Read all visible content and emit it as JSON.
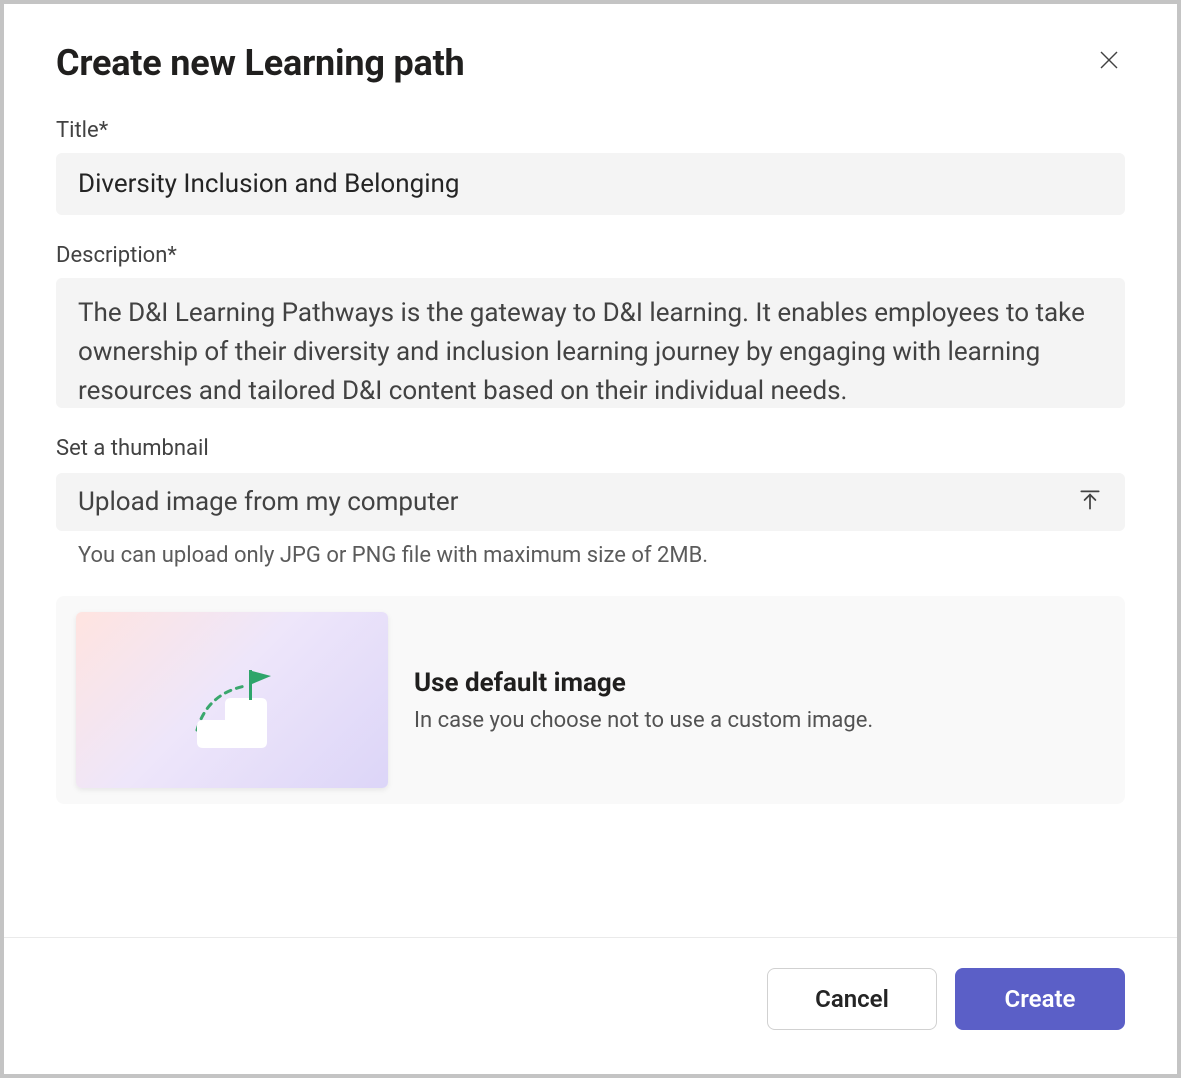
{
  "dialog": {
    "title": "Create new Learning path"
  },
  "fields": {
    "title": {
      "label": "Title*",
      "value": "Diversity Inclusion and Belonging"
    },
    "description": {
      "label": "Description*",
      "value": "The D&I Learning Pathways is the gateway to D&I learning. It enables employees to take ownership of their diversity and inclusion learning journey by engaging with learning resources and tailored D&I content based on their individual needs."
    },
    "thumbnail": {
      "label": "Set a thumbnail",
      "upload_text": "Upload image from my computer",
      "helper": "You can upload only JPG or PNG file with maximum size of 2MB."
    }
  },
  "default_image_card": {
    "title": "Use default image",
    "subtitle": "In case you choose not to use a custom image."
  },
  "footer": {
    "cancel": "Cancel",
    "create": "Create"
  }
}
